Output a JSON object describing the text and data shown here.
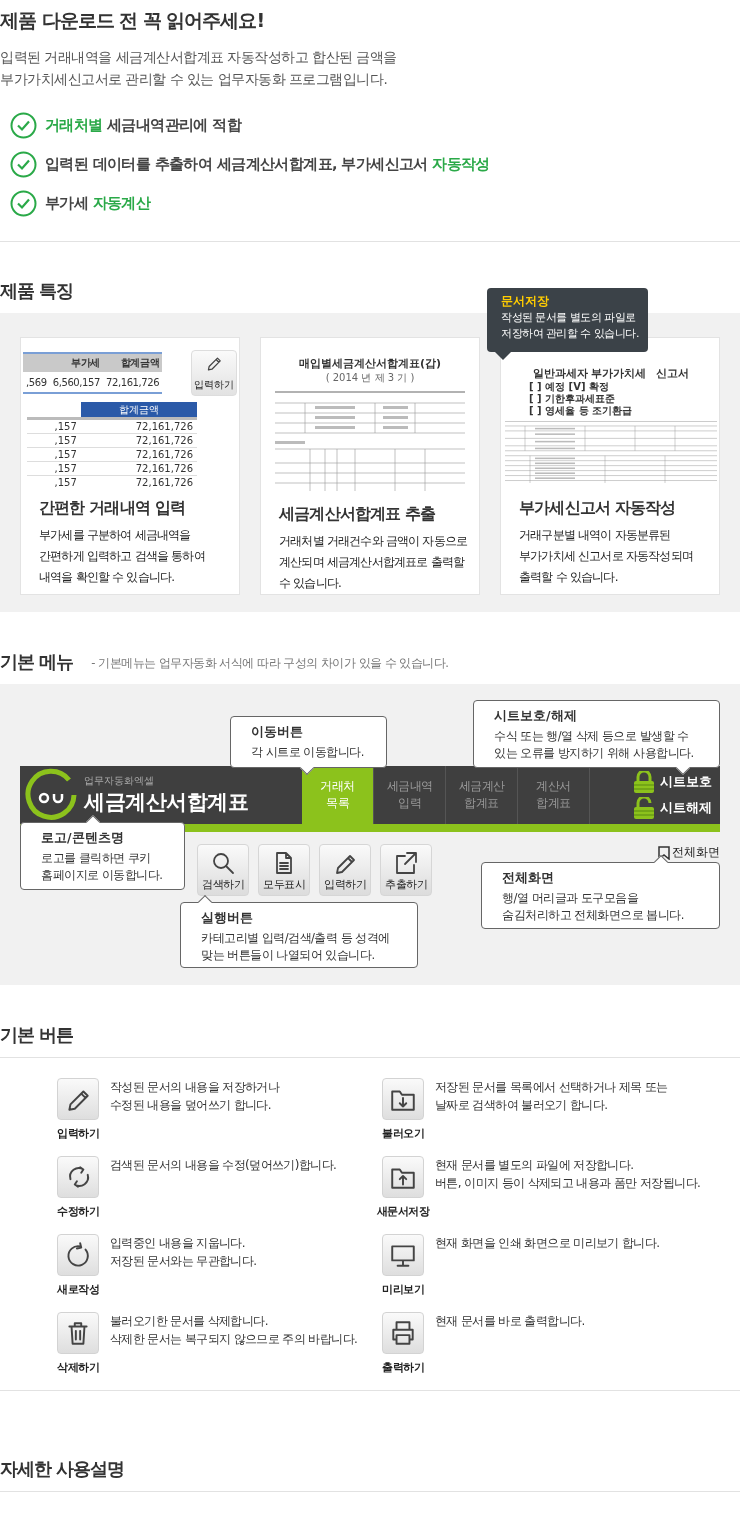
{
  "intro": {
    "title": "제품 다운로드 전 꼭 읽어주세요!",
    "description": [
      "입력된 거래내역을 세금계산서합계표 자동작성하고 합산된 금액을",
      "부가가치세신고서로 관리할 수 있는 업무자동화 프로그램입니다."
    ],
    "checks": [
      {
        "parts": [
          {
            "text": "거래처별",
            "highlight": true
          },
          {
            "text": " 세금내역관리에 적합",
            "highlight": false
          }
        ]
      },
      {
        "parts": [
          {
            "text": "입력된 데이터를 추출하여 세금계산서합계표, 부가세신고서 ",
            "highlight": false
          },
          {
            "text": "자동작성",
            "highlight": true
          }
        ]
      },
      {
        "parts": [
          {
            "text": "부가세 ",
            "highlight": false
          },
          {
            "text": "자동계산",
            "highlight": true
          }
        ]
      }
    ]
  },
  "features": {
    "title": "제품 특징",
    "tooltip": {
      "title": "문서저장",
      "text": "작성된 문서를 별도의 파일로\n저장하여 관리할 수 있습니다."
    },
    "cards": [
      {
        "kind": "spreadsheet",
        "title": "간편한 거래내역 입력",
        "description": "부가세를 구분하여 세금내역을\n간편하게 입력하고 검색을 통하여\n내역을 확인할 수 있습니다.",
        "preview": {
          "top_headers": [
            "부가세",
            "합계금액"
          ],
          "top_values": [
            ",569",
            "6,560,157",
            "72,161,726"
          ],
          "button": "입력하기",
          "bottom_header": "합계금액",
          "rows": [
            [
              ",157",
              "72,161,726"
            ],
            [
              ",157",
              "72,161,726"
            ],
            [
              ",157",
              "72,161,726"
            ],
            [
              ",157",
              "72,161,726"
            ],
            [
              ",157",
              "72,161,726"
            ]
          ]
        }
      },
      {
        "kind": "document",
        "title": "세금계산서합계표 추출",
        "description": "거래처별 거래건수와 금액이 자동으로\n계산되며 세금계산서합계표로 출력할\n수 있습니다.",
        "preview": {
          "heading": "매입별세금계산서합계표(갑)",
          "subheading": "( 2014 년 제 3 기 )"
        }
      },
      {
        "kind": "form",
        "title": "부가세신고서 자동작성",
        "description": "거래구분별 내역이 자동분류된\n부가가치세 신고서로 자동작성되며\n출력할 수 있습니다.",
        "preview": {
          "heading": "일반과세자 부가가치세",
          "options": [
            "[ ] 예정 [V] 확정",
            "[ ] 기한후과세표준",
            "[ ] 영세율 등 조기환급"
          ],
          "suffix": "신고서"
        }
      }
    ]
  },
  "menu": {
    "title": "기본 메뉴",
    "note": "- 기본메뉴는 업무자동화 서식에 따라 구성의 차이가 있을 수 있습니다.",
    "app": {
      "subtitle": "업무자동화엑셀",
      "name": "세금계산서합계표",
      "tabs": [
        {
          "label": "거래처\n목록",
          "selected": true
        },
        {
          "label": "세금내역\n입력",
          "selected": false
        },
        {
          "label": "세금계산\n합계표",
          "selected": false
        },
        {
          "label": "계산서\n합계표",
          "selected": false
        }
      ],
      "sheet_buttons": [
        {
          "label": "시트보호",
          "kind": "locked"
        },
        {
          "label": "시트해제",
          "kind": "unlocked"
        }
      ],
      "actions": [
        {
          "label": "검색하기",
          "kind": "search"
        },
        {
          "label": "모두표시",
          "kind": "document"
        },
        {
          "label": "입력하기",
          "kind": "pencil"
        },
        {
          "label": "추출하기",
          "kind": "export"
        }
      ],
      "fullscreen": "전체화면"
    },
    "callouts": [
      {
        "title": "이동버튼",
        "text": "각 시트로 이동합니다."
      },
      {
        "title": "시트보호/해제",
        "text": "수식 또는 행/열 삭제 등으로 발생할 수\n있는 오류를 방지하기 위해 사용합니다."
      },
      {
        "title": "로고/콘텐츠명",
        "text": "로고를 클릭하면 쿠키\n홈페이지로 이동합니다."
      },
      {
        "title": "실행버튼",
        "text": "카테고리별 입력/검색/출력 등 성격에\n맞는 버튼들이 나열되어 있습니다."
      },
      {
        "title": "전체화면",
        "text": "행/열 머리글과 도구모음을\n숨김처리하고 전체화면으로 봅니다."
      }
    ]
  },
  "buttons": {
    "title": "기본 버튼",
    "items": [
      {
        "kind": "pencil",
        "label": "입력하기",
        "text": "작성된 문서의 내용을 저장하거나\n수정된 내용을 덮어쓰기 합니다."
      },
      {
        "kind": "folder-down",
        "label": "불러오기",
        "text": "저장된 문서를 목록에서 선택하거나 제목 또는\n날짜로 검색하여 불러오기 합니다."
      },
      {
        "kind": "refresh",
        "label": "수정하기",
        "text": "검색된 문서의 내용을 수정(덮어쓰기)합니다."
      },
      {
        "kind": "folder-up",
        "label": "새문서저장",
        "text": "현재 문서를 별도의 파일에 저장합니다.\n버튼, 이미지 등이 삭제되고 내용과 폼만 저장됩니다."
      },
      {
        "kind": "reload",
        "label": "새로작성",
        "text": "입력중인 내용을 지웁니다.\n저장된 문서와는 무관합니다."
      },
      {
        "kind": "monitor",
        "label": "미리보기",
        "text": "현재 화면을 인쇄 화면으로 미리보기 합니다."
      },
      {
        "kind": "trash",
        "label": "삭제하기",
        "text": "불러오기한 문서를 삭제합니다.\n삭제한 문서는 복구되지 않으므로 주의 바랍니다."
      },
      {
        "kind": "printer",
        "label": "출력하기",
        "text": "현재 문서를 바로 출력합니다."
      }
    ]
  },
  "manual": {
    "title": "자세한 사용설명"
  }
}
